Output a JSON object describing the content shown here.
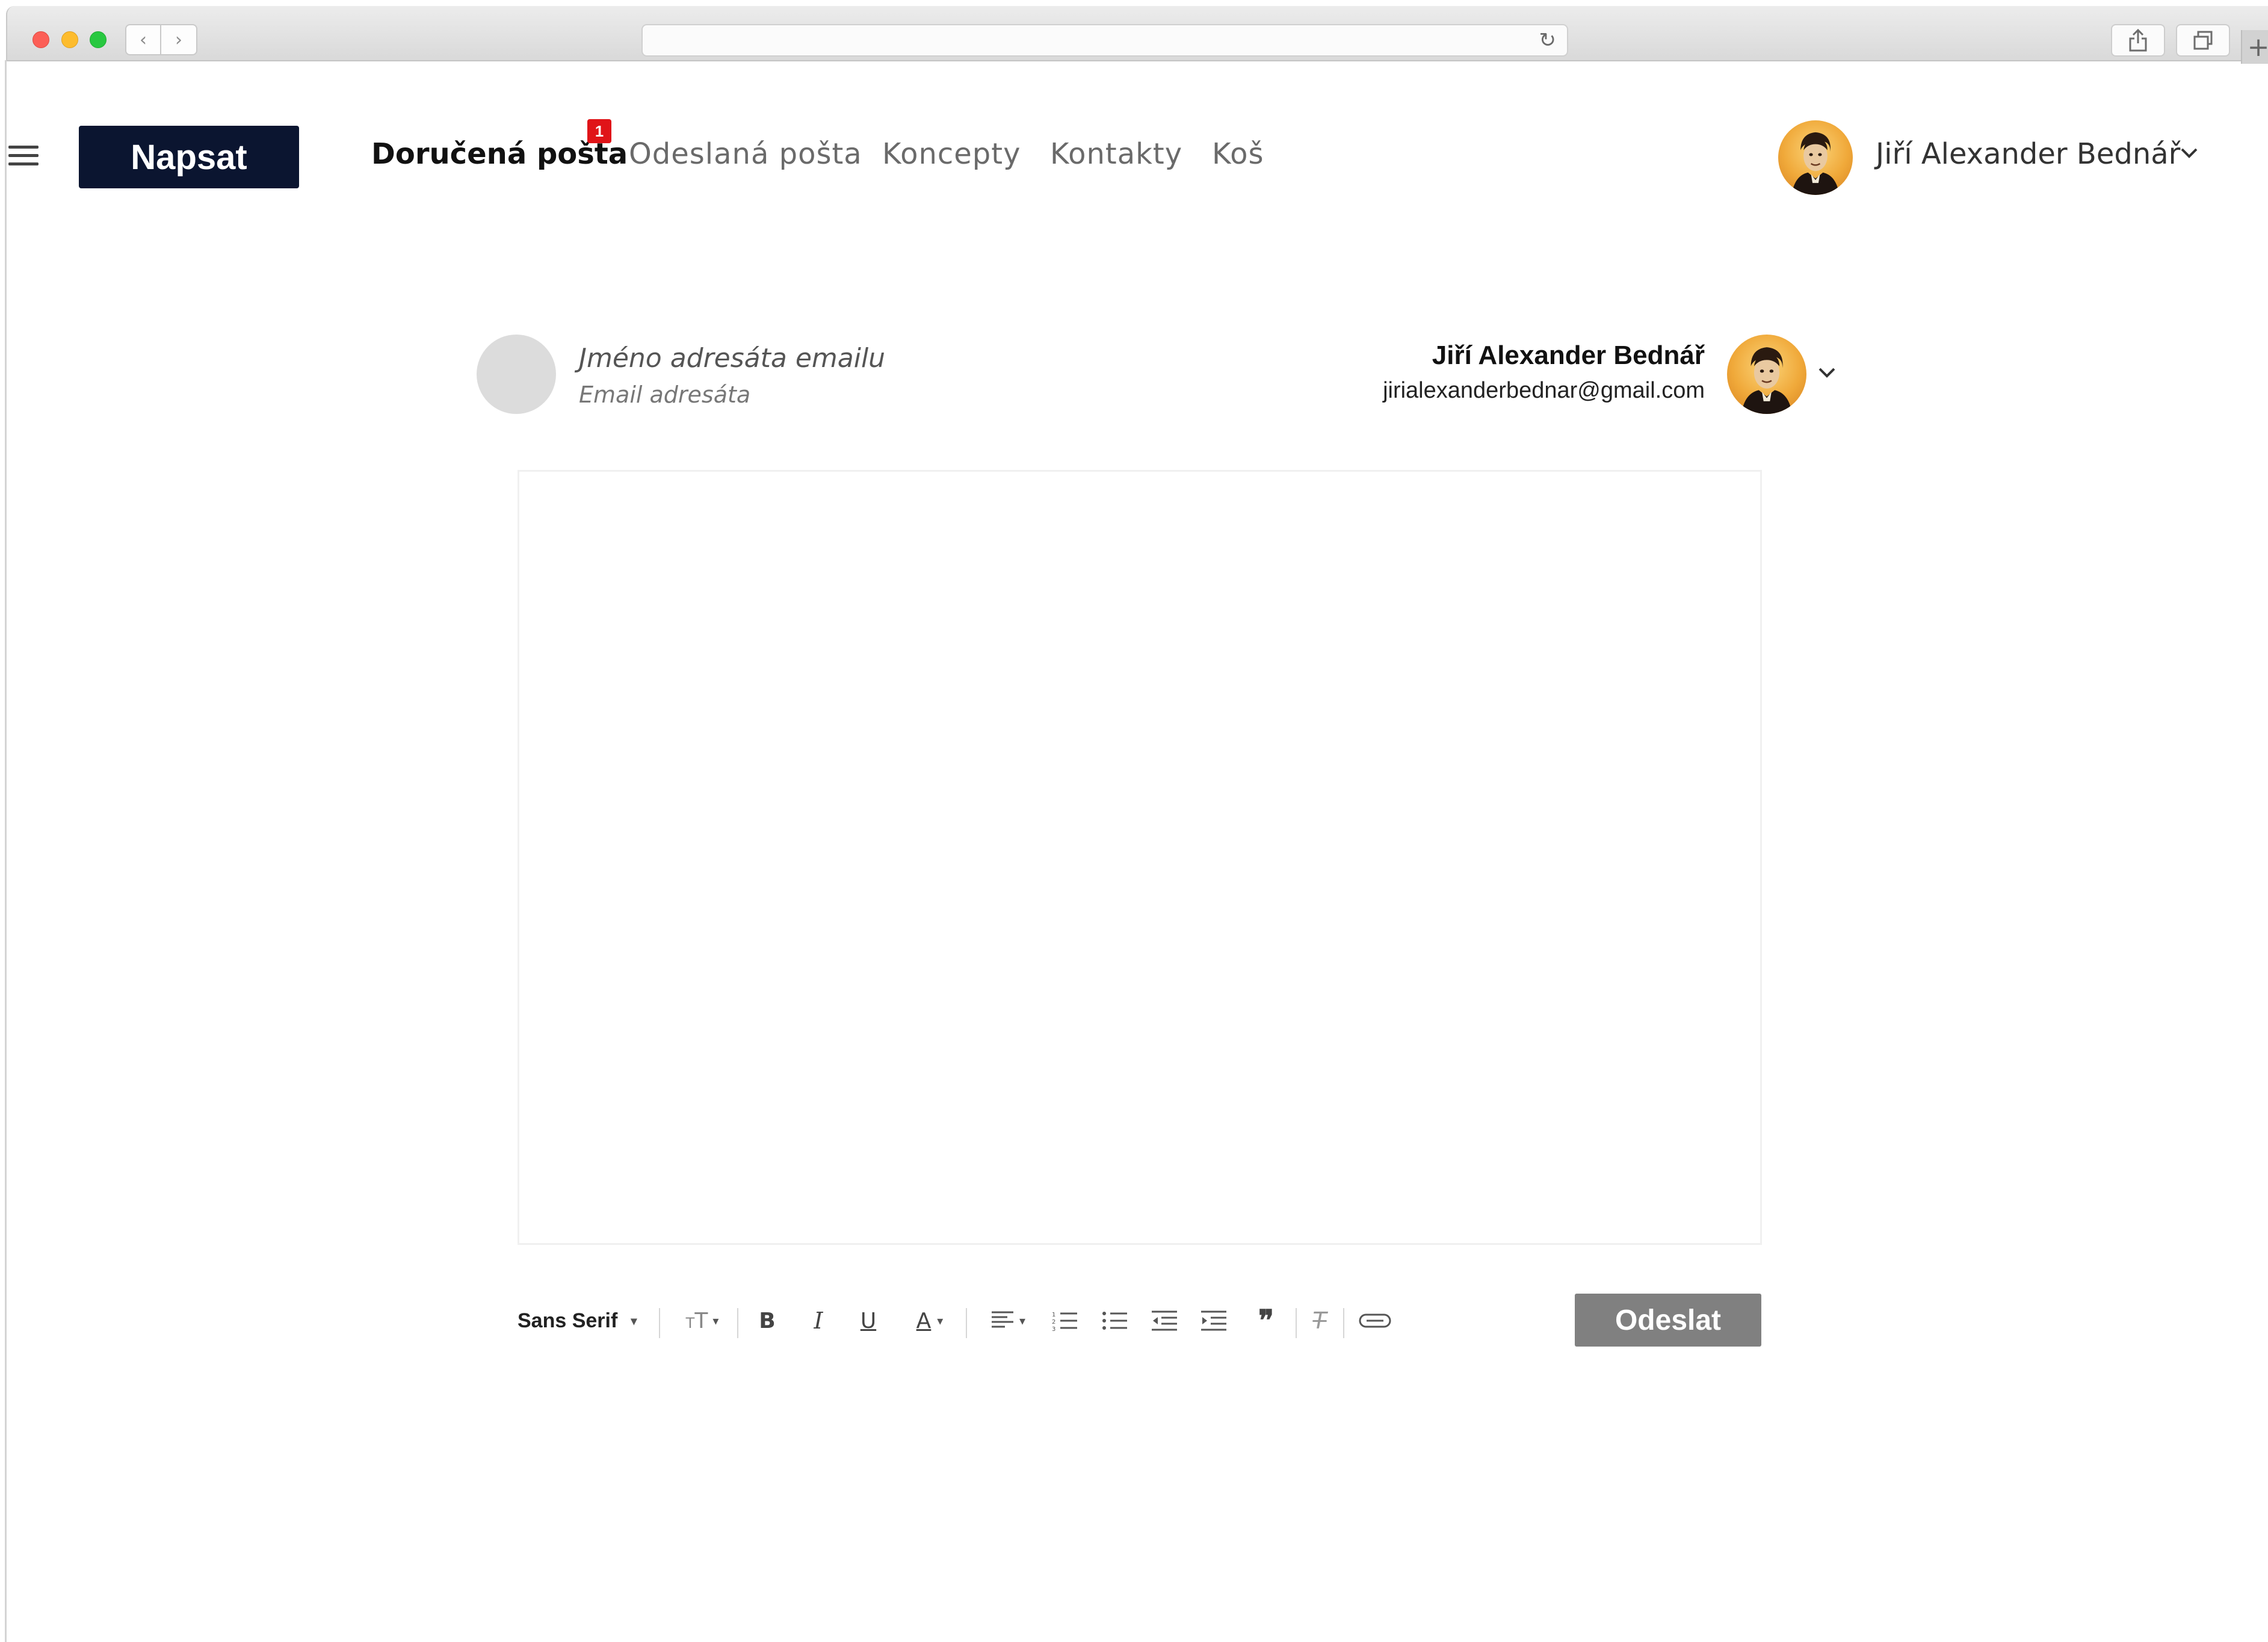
{
  "compose_button": "Napsat",
  "nav": {
    "inbox": "Doručená pošta",
    "inbox_badge": "1",
    "sent": "Odeslaná pošta",
    "drafts": "Koncepty",
    "contacts": "Kontakty",
    "trash": "Koš"
  },
  "user": {
    "name": "Jiří Alexander Bednář",
    "email": "jirialexanderbednar@gmail.com"
  },
  "recipient": {
    "name_placeholder": "Jméno adresáta emailu",
    "email_placeholder": "Email adresáta"
  },
  "toolbar": {
    "font": "Sans Serif",
    "icons": [
      "font-size-icon",
      "bold-icon",
      "italic-icon",
      "underline-icon",
      "text-color-icon",
      "align-icon",
      "numbered-list-icon",
      "bulleted-list-icon",
      "indent-less-icon",
      "indent-more-icon",
      "quote-icon",
      "remove-formatting-icon",
      "attachment-icon"
    ]
  },
  "send_button": "Odeslat",
  "colors": {
    "compose_button_bg": "#0b1530",
    "badge": "#e01418",
    "send_button_bg": "#808080"
  }
}
